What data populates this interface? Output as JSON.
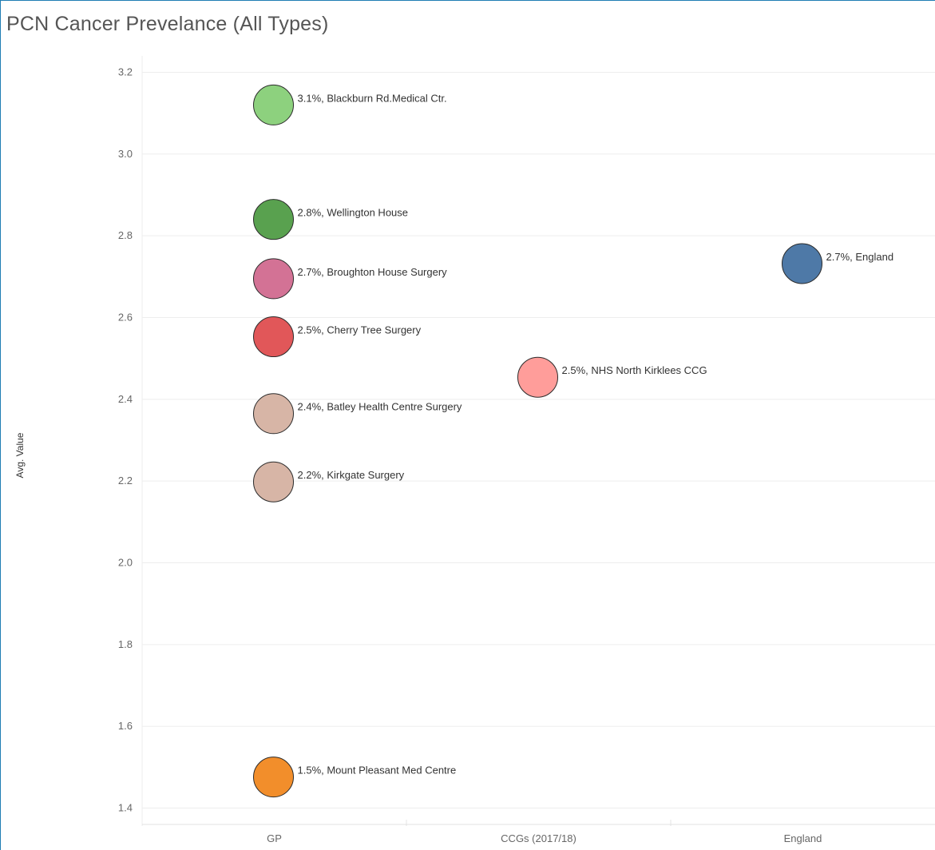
{
  "title": "PCN Cancer Prevelance (All Types)",
  "chart_data": {
    "type": "scatter",
    "title": "PCN Cancer Prevelance (All Types)",
    "xlabel": "",
    "ylabel": "Avg. Value",
    "categories": [
      "GP",
      "CCGs (2017/18)",
      "England"
    ],
    "ylim": [
      1.36,
      3.24
    ],
    "yticks": [
      1.4,
      1.6,
      1.8,
      2.0,
      2.2,
      2.4,
      2.6,
      2.8,
      3.0,
      3.2
    ],
    "grid": true,
    "points": [
      {
        "category": "GP",
        "y": 3.12,
        "label": "3.1%, Blackburn Rd.Medical Ctr.",
        "color": "#8dd17e"
      },
      {
        "category": "GP",
        "y": 2.84,
        "label": "2.8%, Wellington House",
        "color": "#59a14f"
      },
      {
        "category": "GP",
        "y": 2.695,
        "label": "2.7%, Broughton House Surgery",
        "color": "#d37295"
      },
      {
        "category": "GP",
        "y": 2.553,
        "label": "2.5%, Cherry Tree Surgery",
        "color": "#e15759"
      },
      {
        "category": "GP",
        "y": 2.365,
        "label": "2.4%, Batley Health Centre Surgery",
        "color": "#d7b5a6"
      },
      {
        "category": "GP",
        "y": 2.198,
        "label": "2.2%, Kirkgate Surgery",
        "color": "#d7b5a6"
      },
      {
        "category": "GP",
        "y": 1.476,
        "label": "1.5%, Mount Pleasant Med Centre",
        "color": "#f28e2b"
      },
      {
        "category": "CCGs (2017/18)",
        "y": 2.454,
        "label": "2.5%, NHS North Kirklees CCG",
        "color": "#ff9d9a"
      },
      {
        "category": "England",
        "y": 2.732,
        "label": "2.7%, England",
        "color": "#4e79a7"
      }
    ]
  }
}
